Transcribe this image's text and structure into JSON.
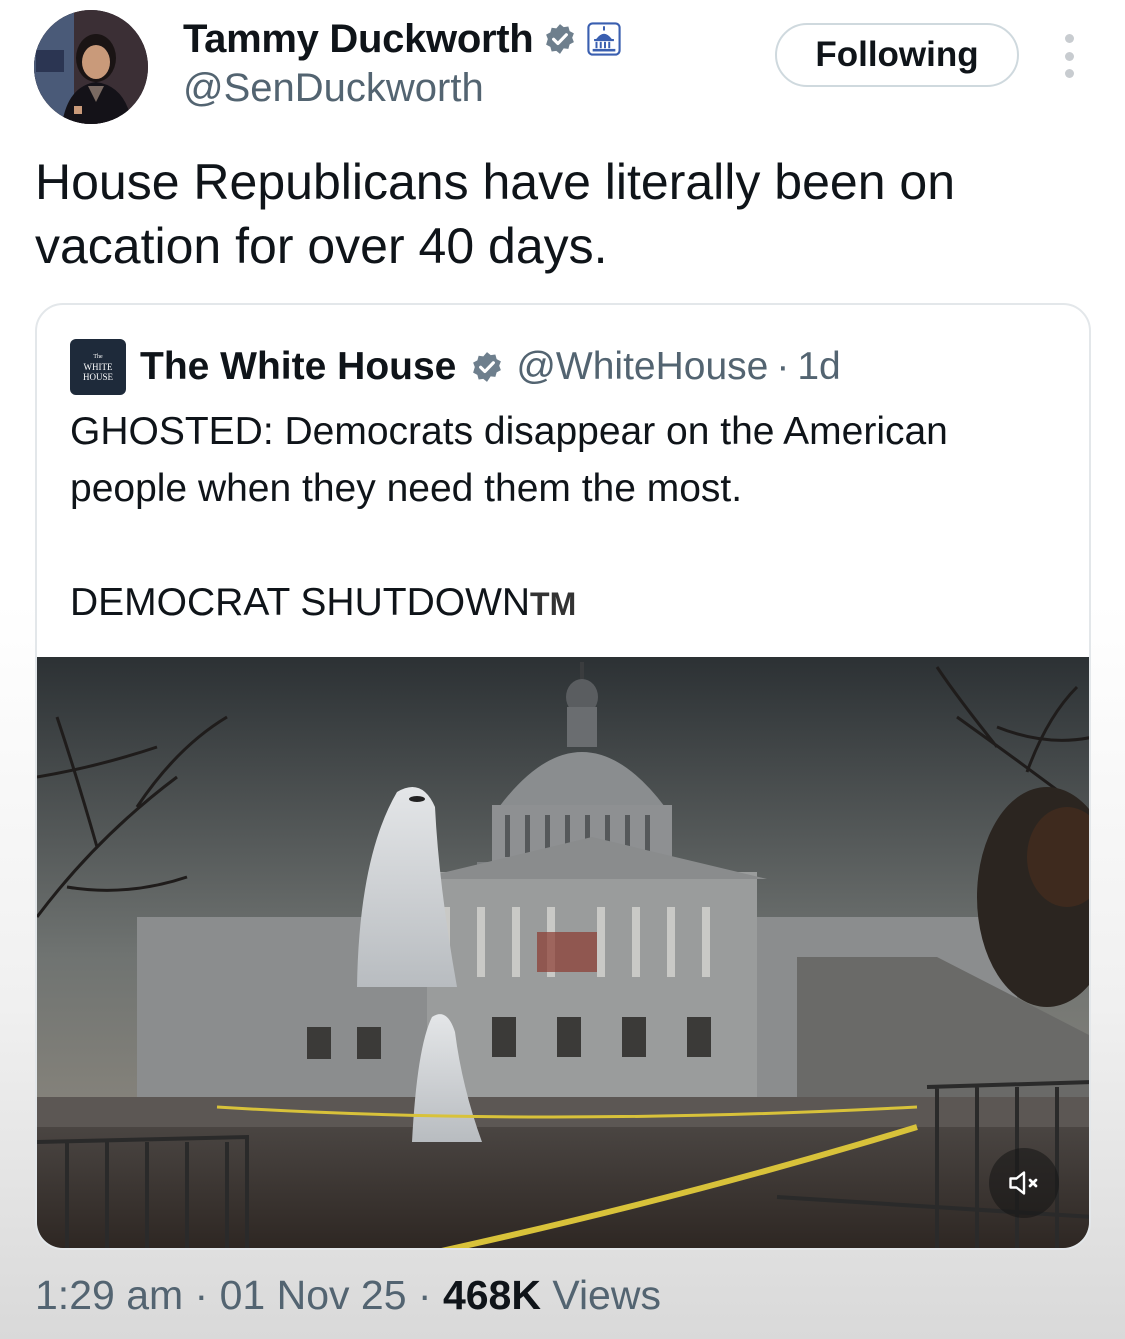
{
  "author": {
    "display_name": "Tammy Duckworth",
    "handle": "@SenDuckworth",
    "verified_icon": "verified-badge-icon",
    "affiliation_icon": "capitol-affiliate-icon"
  },
  "follow_button": {
    "label": "Following"
  },
  "more_icon": "more-vertical-icon",
  "tweet": {
    "text": "House Republicans have literally been on vacation for over 40 days."
  },
  "quoted": {
    "logo_text": {
      "top": "The",
      "line1": "WHITE",
      "line2": "HOUSE"
    },
    "display_name": "The White House",
    "handle": "@WhiteHouse",
    "separator": "·",
    "time": "1d",
    "paragraph1": "GHOSTED: Democrats disappear on the American people when they need them the most.",
    "paragraph2_main": "DEMOCRAT SHUTDOWN",
    "paragraph2_tm": "TM",
    "media": {
      "type": "video",
      "muted_icon": "speaker-muted-icon"
    }
  },
  "meta": {
    "time": "1:29 am",
    "sep1": " · ",
    "date": "01 Nov 25",
    "sep2": " · ",
    "views_count": "468K",
    "views_label": " Views"
  },
  "colors": {
    "verified_badge": "#6e7f8d",
    "secondary_text": "#536471",
    "follow_border": "#cfd9de"
  }
}
